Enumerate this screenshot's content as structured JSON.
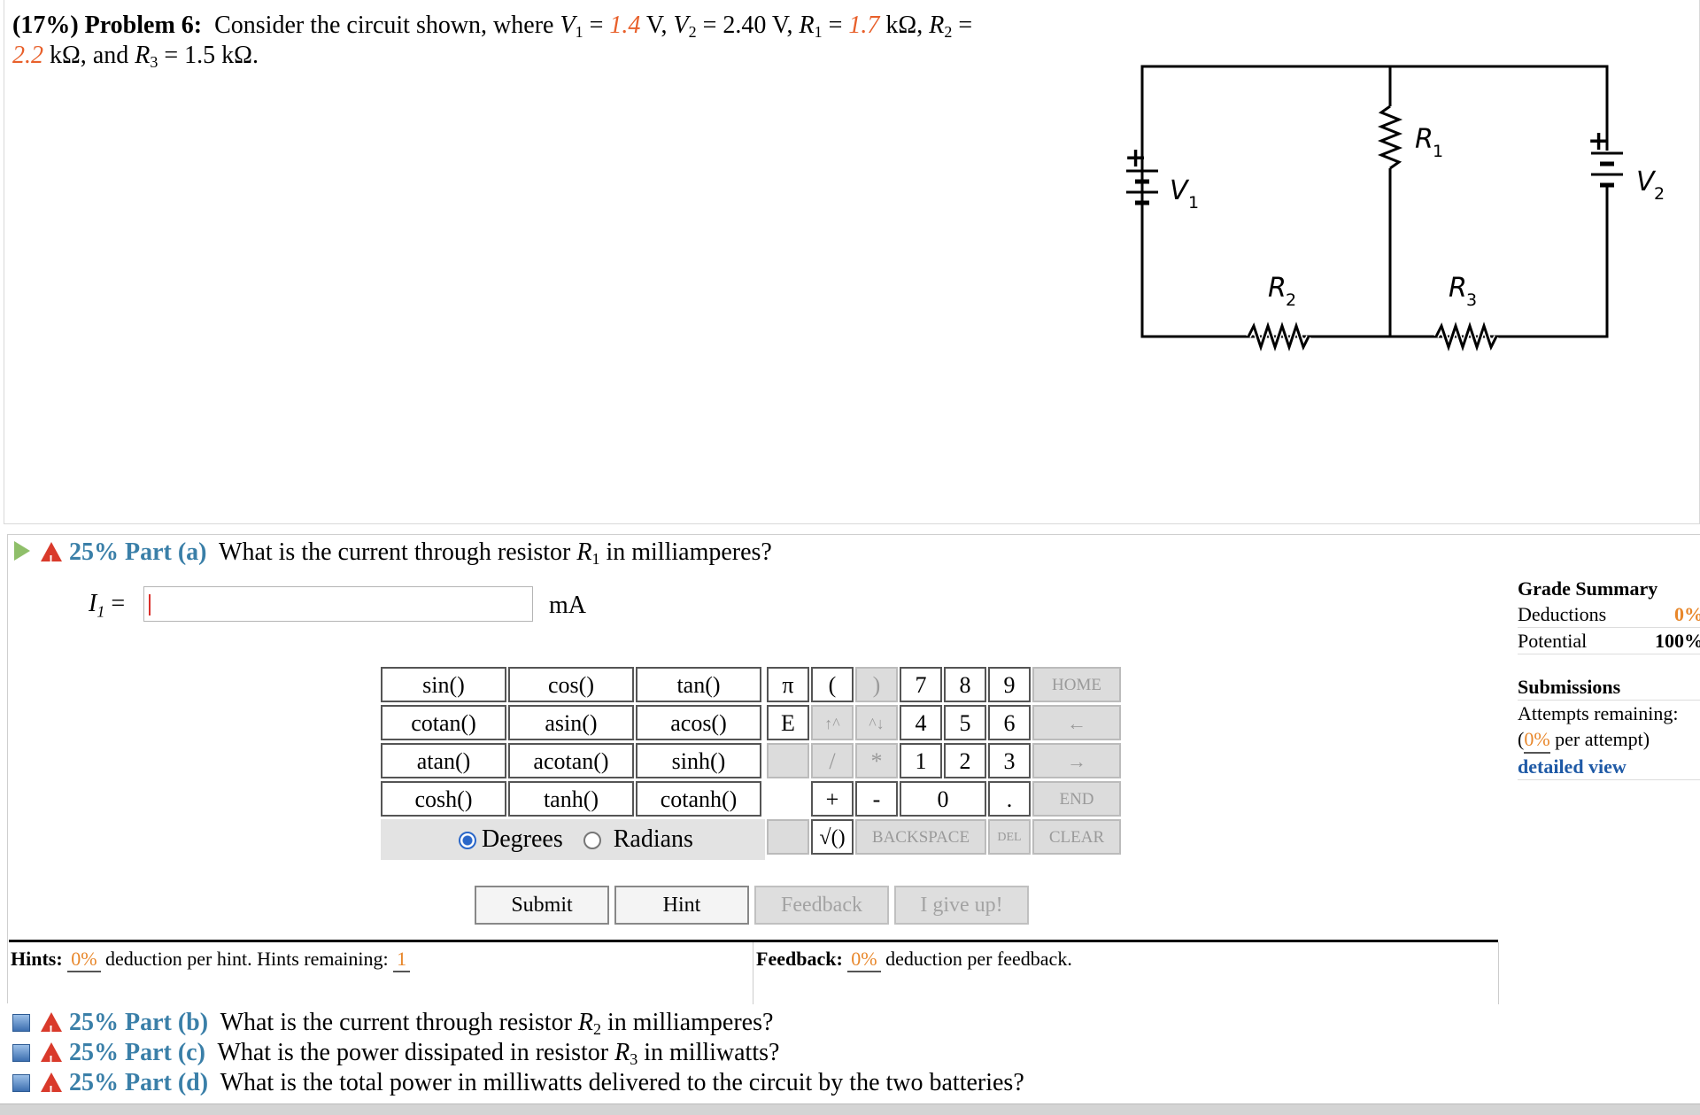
{
  "problem": {
    "weight": "(17%)",
    "number": "Problem 6:",
    "text_intro": "Consider the circuit shown, where",
    "V1_value": "1.4",
    "V2_value": "2.40",
    "R1_value": "1.7",
    "R2_value": "2.2",
    "R3_value": "1.5",
    "and_word": "and"
  },
  "circuit": {
    "labels": {
      "R1": "R",
      "R1_sub": "1",
      "R2": "R",
      "R2_sub": "2",
      "R3": "R",
      "R3_sub": "3",
      "V1": "V",
      "V1_sub": "1",
      "V2": "V",
      "V2_sub": "2",
      "plus": "+"
    }
  },
  "part_a": {
    "percent": "25%",
    "label": "Part (a)",
    "question": "What is the current through resistor",
    "question_end": "in milliamperes?",
    "answer_symbol": "I",
    "answer_sub": "1",
    "answer_eq": "=",
    "answer_value": "",
    "unit": "mA"
  },
  "calculator": {
    "functions": [
      "sin()",
      "cos()",
      "tan()",
      "cotan()",
      "asin()",
      "acos()",
      "atan()",
      "acotan()",
      "sinh()",
      "cosh()",
      "tanh()",
      "cotanh()"
    ],
    "degrees": "Degrees",
    "radians": "Radians",
    "keys": {
      "pi": "π",
      "lparen": "(",
      "rparen": ")",
      "E": "E",
      "up": "↑^",
      "down": "^↓",
      "slash": "/",
      "star": "*",
      "plus": "+",
      "minus": "-",
      "sqrt": "√()",
      "dot": ".",
      "n7": "7",
      "n8": "8",
      "n9": "9",
      "n4": "4",
      "n5": "5",
      "n6": "6",
      "n1": "1",
      "n2": "2",
      "n3": "3",
      "n0": "0",
      "home": "HOME",
      "left": "←",
      "right": "→",
      "end": "END",
      "backspace": "BACKSPACE",
      "del": "DEL",
      "clear": "CLEAR"
    }
  },
  "actions": {
    "submit": "Submit",
    "hint": "Hint",
    "feedback": "Feedback",
    "giveup": "I give up!"
  },
  "hints": {
    "label": "Hints:",
    "pct": "0%",
    "text": "deduction per hint. Hints remaining:",
    "remaining": "1"
  },
  "feedback": {
    "label": "Feedback:",
    "pct": "0%",
    "text": "deduction per feedback."
  },
  "grade_summary": {
    "title": "Grade Summary",
    "deductions_label": "Deductions",
    "deductions_value": "0%",
    "potential_label": "Potential",
    "potential_value": "100%",
    "submissions_title": "Submissions",
    "attempts_label": "Attempts remaining:",
    "per_attempt_pct": "0%",
    "per_attempt_text": "per attempt)",
    "detailed_view": "detailed view"
  },
  "other_parts": [
    {
      "percent": "25%",
      "label": "Part (b)",
      "question": "What is the current through resistor",
      "sym": "R",
      "sub": "2",
      "end": "in milliamperes?"
    },
    {
      "percent": "25%",
      "label": "Part (c)",
      "question": "What is the power dissipated in resistor",
      "sym": "R",
      "sub": "3",
      "end": "in milliwatts?"
    },
    {
      "percent": "25%",
      "label": "Part (d)",
      "question": "What is the total power in milliwatts delivered to the circuit by the two batteries?",
      "sym": "",
      "sub": "",
      "end": ""
    }
  ]
}
